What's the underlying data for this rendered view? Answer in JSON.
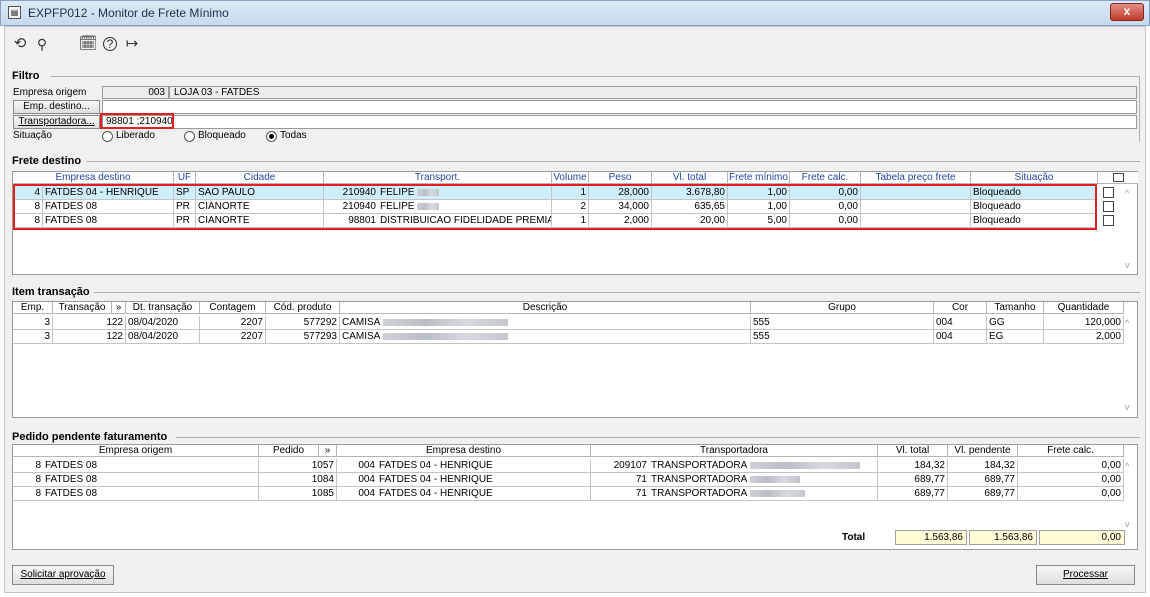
{
  "window": {
    "title": "EXPFP012 - Monitor de Frete Mínimo",
    "close_label": "x"
  },
  "toolbar": [
    {
      "name": "refresh-icon",
      "glyph": "⟲"
    },
    {
      "name": "search-icon",
      "glyph": "🔍"
    },
    {
      "name": "calendar-icon",
      "glyph": "🗓"
    },
    {
      "name": "help-icon",
      "glyph": "?"
    },
    {
      "name": "exit-icon",
      "glyph": "⇥"
    }
  ],
  "filtro": {
    "title": "Filtro",
    "empresa_origem_label": "Empresa origem",
    "empresa_origem_code": "003",
    "empresa_origem_name": "LOJA 03 - FATDES",
    "emp_destino_button": "Emp. destino...",
    "emp_destino_value": "",
    "transportadora_button": "Transportadora...",
    "transportadora_value": "98801 ;210940",
    "situacao_label": "Situação",
    "situacao_options": [
      "Liberado",
      "Bloqueado",
      "Todas"
    ],
    "situacao_selected": "Todas"
  },
  "frete": {
    "title": "Frete destino",
    "headers": [
      "Empresa destino",
      "UF",
      "Cidade",
      "Transport.",
      "Volume",
      "Peso",
      "Vl. total",
      "Frete mínimo",
      "Frete calc.",
      "Tabela preço frete",
      "Situação"
    ],
    "rows": [
      {
        "emp_code": "4",
        "emp_name": "FATDES 04 - HENRIQUE",
        "uf": "SP",
        "cidade": "SAO PAULO",
        "transp_code": "210940",
        "transp_name": "FELIPE",
        "volume": "1",
        "peso": "28,000",
        "vl_total": "3.678,80",
        "frete_min": "1,00",
        "frete_calc": "0,00",
        "tabela": "",
        "situacao": "Bloqueado"
      },
      {
        "emp_code": "8",
        "emp_name": "FATDES 08",
        "uf": "PR",
        "cidade": "CIANORTE",
        "transp_code": "210940",
        "transp_name": "FELIPE",
        "volume": "2",
        "peso": "34,000",
        "vl_total": "635,65",
        "frete_min": "1,00",
        "frete_calc": "0,00",
        "tabela": "",
        "situacao": "Bloqueado"
      },
      {
        "emp_code": "8",
        "emp_name": "FATDES 08",
        "uf": "PR",
        "cidade": "CIANORTE",
        "transp_code": "98801",
        "transp_name": "DISTRIBUICAO FIDELIDADE PREMIADA",
        "volume": "1",
        "peso": "2,000",
        "vl_total": "20,00",
        "frete_min": "5,00",
        "frete_calc": "0,00",
        "tabela": "",
        "situacao": "Bloqueado"
      }
    ]
  },
  "item": {
    "title": "Item transação",
    "headers": [
      "Emp.",
      "Transação",
      "»",
      "Dt. transação",
      "Contagem",
      "Cód. produto",
      "Descrição",
      "Grupo",
      "Cor",
      "Tamanho",
      "Quantidade"
    ],
    "rows": [
      {
        "emp": "3",
        "transacao": "122",
        "dt": "08/04/2020",
        "contagem": "2207",
        "cod": "577292",
        "descricao": "CAMISA",
        "grupo": "555",
        "cor": "004",
        "tamanho": "GG",
        "quantidade": "120,000"
      },
      {
        "emp": "3",
        "transacao": "122",
        "dt": "08/04/2020",
        "contagem": "2207",
        "cod": "577293",
        "descricao": "CAMISA",
        "grupo": "555",
        "cor": "004",
        "tamanho": "EG",
        "quantidade": "2,000"
      }
    ]
  },
  "pedido": {
    "title": "Pedido pendente faturamento",
    "headers": [
      "Empresa origem",
      "Pedido",
      "»",
      "Empresa destino",
      "Transportadora",
      "Vl. total",
      "Vl. pendente",
      "Frete calc."
    ],
    "rows": [
      {
        "orig_code": "8",
        "orig_name": "FATDES 08",
        "pedido": "1057",
        "dest_code": "004",
        "dest_name": "FATDES 04 - HENRIQUE",
        "transp_code": "209107",
        "transp_name": "TRANSPORTADORA",
        "vl_total": "184,32",
        "vl_pendente": "184,32",
        "frete_calc": "0,00"
      },
      {
        "orig_code": "8",
        "orig_name": "FATDES 08",
        "pedido": "1084",
        "dest_code": "004",
        "dest_name": "FATDES 04 - HENRIQUE",
        "transp_code": "71",
        "transp_name": "TRANSPORTADORA",
        "vl_total": "689,77",
        "vl_pendente": "689,77",
        "frete_calc": "0,00"
      },
      {
        "orig_code": "8",
        "orig_name": "FATDES 08",
        "pedido": "1085",
        "dest_code": "004",
        "dest_name": "FATDES 04 - HENRIQUE",
        "transp_code": "71",
        "transp_name": "TRANSPORTADORA",
        "vl_total": "689,77",
        "vl_pendente": "689,77",
        "frete_calc": "0,00"
      }
    ],
    "total_label": "Total",
    "total_vl_total": "1.563,86",
    "total_vl_pendente": "1.563,86",
    "total_frete_calc": "0,00"
  },
  "buttons": {
    "solicitar": "Solicitar aprovação",
    "processar": "Processar"
  },
  "colors": {
    "highlight_row": "#cdeefa",
    "red_outline": "#e02020",
    "total_yellow": "#fffbd6"
  }
}
